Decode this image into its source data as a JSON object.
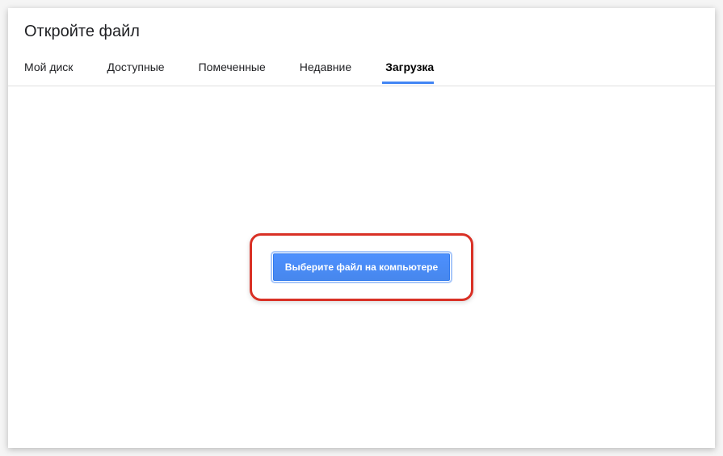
{
  "dialog": {
    "title": "Откройте файл"
  },
  "tabs": [
    {
      "label": "Мой диск",
      "active": false
    },
    {
      "label": "Доступные",
      "active": false
    },
    {
      "label": "Помеченные",
      "active": false
    },
    {
      "label": "Недавние",
      "active": false
    },
    {
      "label": "Загрузка",
      "active": true
    }
  ],
  "upload": {
    "select_button_label": "Выберите файл на компьютере"
  },
  "colors": {
    "accent": "#4285f4",
    "button_bg": "#4d90fe",
    "highlight_border": "#d93025"
  }
}
